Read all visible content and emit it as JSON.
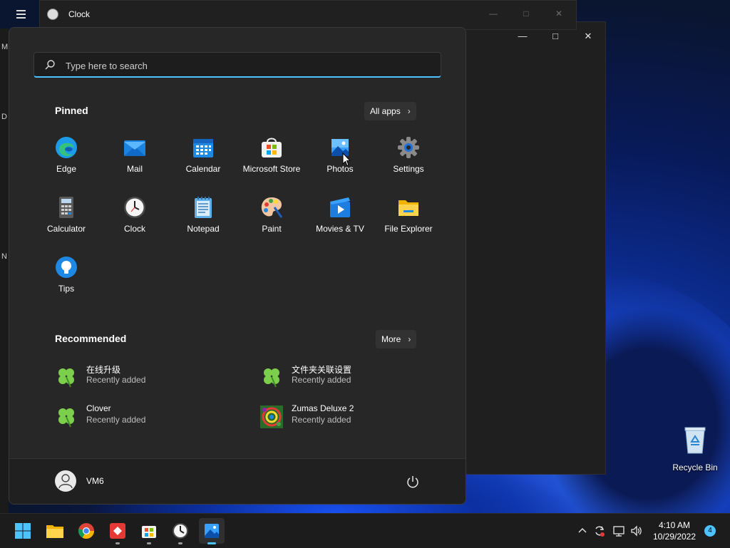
{
  "clock_window": {
    "title": "Clock"
  },
  "left_edge_letters": [
    "M",
    "D",
    "N"
  ],
  "search": {
    "placeholder": "Type here to search"
  },
  "pinned": {
    "title": "Pinned",
    "all_apps_label": "All apps",
    "apps": [
      {
        "label": "Edge",
        "icon": "edge-icon"
      },
      {
        "label": "Mail",
        "icon": "mail-icon"
      },
      {
        "label": "Calendar",
        "icon": "calendar-icon"
      },
      {
        "label": "Microsoft Store",
        "icon": "store-icon"
      },
      {
        "label": "Photos",
        "icon": "photos-icon"
      },
      {
        "label": "Settings",
        "icon": "gear-icon"
      },
      {
        "label": "Calculator",
        "icon": "calculator-icon"
      },
      {
        "label": "Clock",
        "icon": "clock-icon"
      },
      {
        "label": "Notepad",
        "icon": "notepad-icon"
      },
      {
        "label": "Paint",
        "icon": "paint-palette-icon"
      },
      {
        "label": "Movies & TV",
        "icon": "movies-icon"
      },
      {
        "label": "File Explorer",
        "icon": "folder-icon"
      },
      {
        "label": "Tips",
        "icon": "lightbulb-icon"
      }
    ]
  },
  "recommended": {
    "title": "Recommended",
    "more_label": "More",
    "items": [
      {
        "name": "在线升级",
        "sub": "Recently added",
        "icon": "clover-icon"
      },
      {
        "name": "文件夹关联设置",
        "sub": "Recently added",
        "icon": "clover-icon"
      },
      {
        "name": "Clover",
        "sub": "Recently added",
        "icon": "clover-icon"
      },
      {
        "name": "Zumas Deluxe 2",
        "sub": "Recently added",
        "icon": "zuma-game-icon"
      }
    ]
  },
  "user": {
    "name": "VM6"
  },
  "desktop": {
    "recycle_bin_label": "Recycle Bin"
  },
  "taskbar": {
    "time": "4:10 AM",
    "date": "10/29/2022",
    "notification_count": "4"
  },
  "colors": {
    "accent": "#4cc2ff",
    "start_bg": "#272727"
  }
}
